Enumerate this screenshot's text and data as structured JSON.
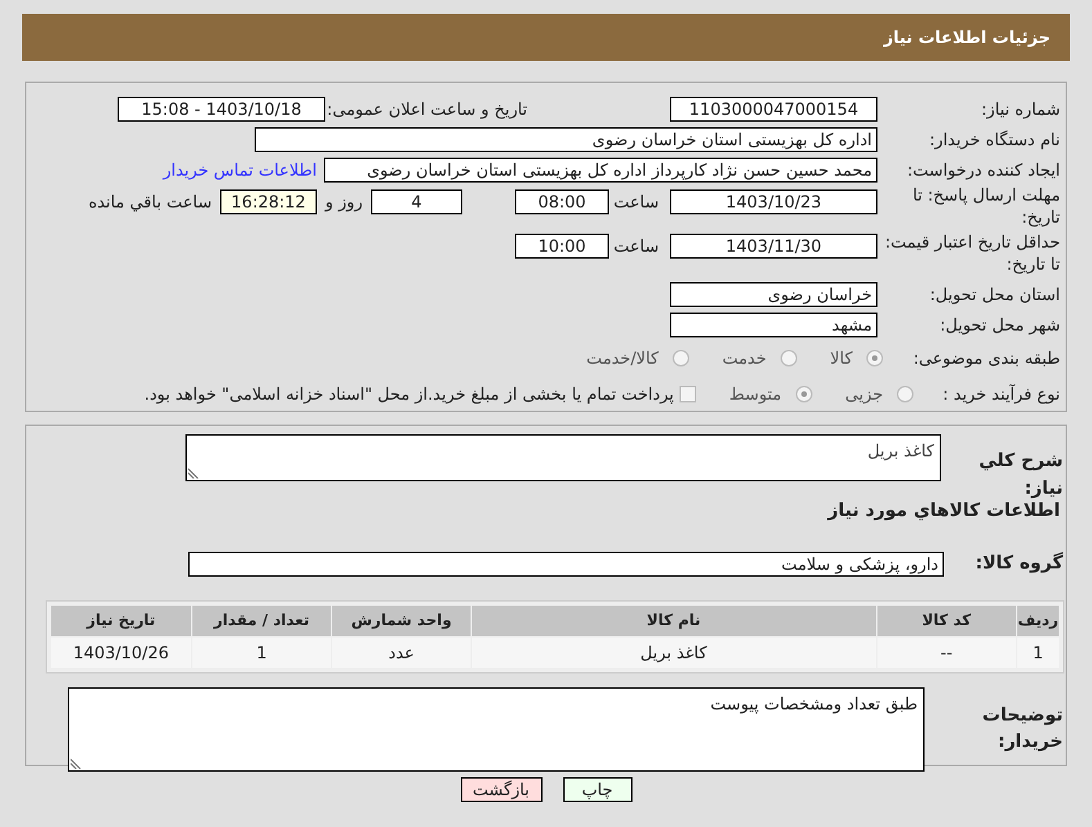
{
  "header": {
    "title": "جزئیات اطلاعات نیاز"
  },
  "details": {
    "need_number": {
      "label": "شماره نیاز:",
      "value": "1103000047000154"
    },
    "announce": {
      "label": "تاریخ و ساعت اعلان عمومی:",
      "value": "1403/10/18 - 15:08"
    },
    "buyer": {
      "label": "نام دستگاه خریدار:",
      "value": "اداره کل بهزیستی استان خراسان رضوی"
    },
    "creator": {
      "label": "ایجاد کننده درخواست:",
      "value": "محمد حسین حسن نژاد کارپرداز اداره کل بهزیستی استان خراسان رضوی",
      "link": "اطلاعات تماس خریدار"
    },
    "deadline": {
      "label": "مهلت ارسال پاسخ: تا تاریخ:",
      "date": "1403/10/23",
      "time_label": "ساعت",
      "time": "08:00",
      "days": "4",
      "days_label": "روز و",
      "remaining": "16:28:12",
      "remaining_label": "ساعت باقي مانده"
    },
    "validity": {
      "label": "حداقل تاریخ اعتبار قیمت: تا تاریخ:",
      "date": "1403/11/30",
      "time_label": "ساعت",
      "time": "10:00"
    },
    "province": {
      "label": "استان محل تحویل:",
      "value": "خراسان رضوی"
    },
    "city": {
      "label": "شهر محل تحویل:",
      "value": "مشهد"
    },
    "category": {
      "label": "طبقه بندی موضوعی:",
      "options": [
        {
          "label": "کالا",
          "selected": true
        },
        {
          "label": "خدمت",
          "selected": false
        },
        {
          "label": "کالا/خدمت",
          "selected": false
        }
      ]
    },
    "process": {
      "label": "نوع فرآیند خرید :",
      "options": [
        {
          "label": "جزیی",
          "selected": false
        },
        {
          "label": "متوسط",
          "selected": true
        }
      ],
      "treasury": {
        "label": "پرداخت تمام یا بخشی از مبلغ خرید.از محل \"اسناد خزانه اسلامی\" خواهد بود.",
        "checked": false
      }
    }
  },
  "goods": {
    "summary": {
      "label": "شرح کلي نیاز:",
      "value": "کاغذ بریل"
    },
    "section_title": "اطلاعات کالاهاي مورد نیاز",
    "group": {
      "label": "گروه کالا:",
      "value": "دارو، پزشکی و سلامت"
    },
    "table": {
      "columns": [
        "ردیف",
        "کد کالا",
        "نام کالا",
        "واحد شمارش",
        "تعداد / مقدار",
        "تاریخ نیاز"
      ],
      "rows": [
        [
          "1",
          "--",
          "کاغذ بریل",
          "عدد",
          "1",
          "1403/10/26"
        ]
      ]
    },
    "notes": {
      "label": "توضیحات خریدار:",
      "value": "طبق تعداد ومشخصات پیوست"
    }
  },
  "buttons": [
    {
      "label": "چاپ",
      "kind": "print"
    },
    {
      "label": "بازگشت",
      "kind": "back"
    }
  ]
}
